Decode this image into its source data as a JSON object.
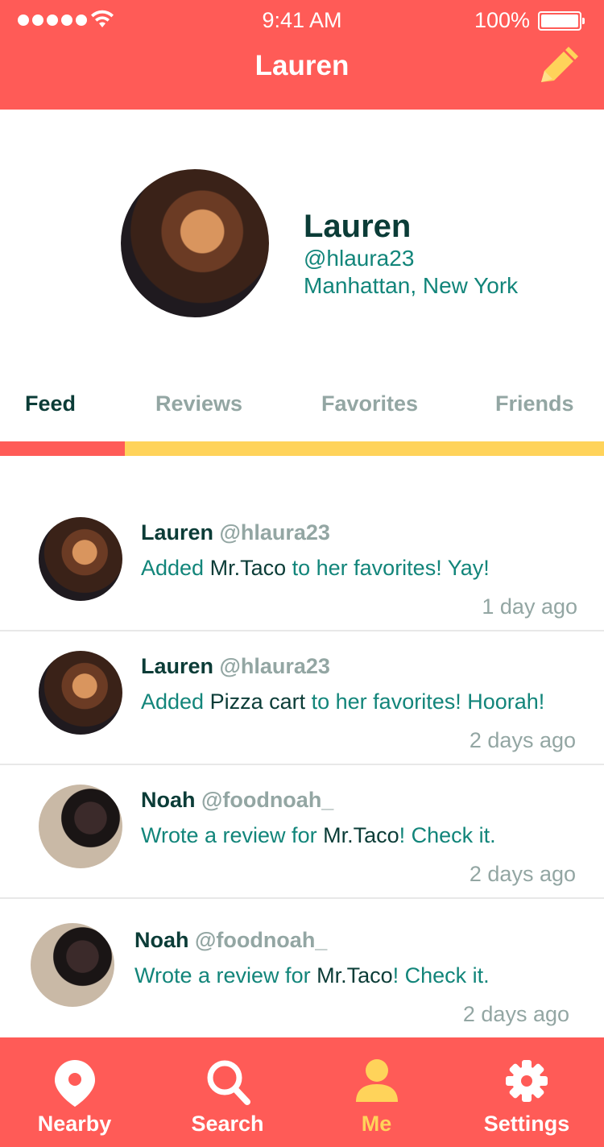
{
  "status_bar": {
    "time": "9:41 AM",
    "battery_percent": "100%"
  },
  "header": {
    "title": "Lauren"
  },
  "profile": {
    "name": "Lauren",
    "handle": "@hlaura23",
    "location": "Manhattan, New York"
  },
  "tabs": [
    {
      "label": "Feed",
      "active": true
    },
    {
      "label": "Reviews",
      "active": false
    },
    {
      "label": "Favorites",
      "active": false
    },
    {
      "label": "Friends",
      "active": false
    }
  ],
  "feed": [
    {
      "name": "Lauren",
      "handle": "@hlaura23",
      "pre": "Added ",
      "object": "Mr.Taco",
      "post": " to her favorites! Yay!",
      "time": "1 day ago"
    },
    {
      "name": "Lauren",
      "handle": "@hlaura23",
      "pre": "Added ",
      "object": "Pizza cart",
      "post": " to her favorites! Hoorah!",
      "time": "2 days ago"
    },
    {
      "name": "Noah",
      "handle": "@foodnoah_",
      "pre": "Wrote a review for ",
      "object": "Mr.Taco",
      "post": "! Check it.",
      "time": "2 days ago"
    },
    {
      "name": "Noah",
      "handle": "@foodnoah_",
      "pre": "Wrote a review for ",
      "object": "Mr.Taco",
      "post": "! Check it.",
      "time": "2 days ago"
    }
  ],
  "nav": [
    {
      "label": "Nearby",
      "icon": "map-pin-icon"
    },
    {
      "label": "Search",
      "icon": "search-icon"
    },
    {
      "label": "Me",
      "icon": "user-icon",
      "active": true
    },
    {
      "label": "Settings",
      "icon": "gear-icon"
    }
  ],
  "colors": {
    "primary": "#ff5b57",
    "accent": "#ffd35a",
    "text_dark": "#0b3c37",
    "text_teal": "#12857a",
    "text_muted": "#93a6a3"
  }
}
